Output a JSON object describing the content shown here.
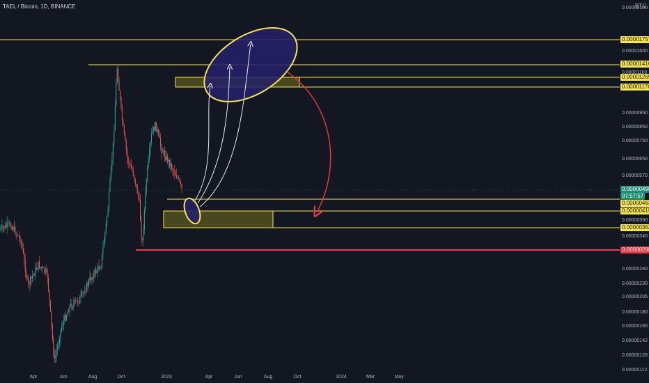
{
  "header": {
    "symbol": "TAEL / Bitcoin, 1D, BINANCE",
    "currency": "BTC"
  },
  "colors": {
    "background": "#131722",
    "up": "#26a69a",
    "down": "#ef5350",
    "yellow": "#f7e54b",
    "zone_fill": "#5b5a1e",
    "ellipse_fill": "#25216b",
    "red_line": "#f23645",
    "current": "#1e8c7a"
  },
  "chart_data": {
    "type": "candlestick",
    "x_ticks": [
      "Apr",
      "Jun",
      "Aug",
      "Oct",
      "2023",
      "Apr",
      "Jun",
      "Aug",
      "Oct",
      "2024",
      "Mar",
      "May"
    ],
    "y_ticks": [
      "0.00002100",
      "0.00001600",
      "0.00001100",
      "0.00000950",
      "0.00000850",
      "0.00000750",
      "0.00000650",
      "0.00000570",
      "0.00000390",
      "0.00000340",
      "0.00000260",
      "0.00000230",
      "0.00000205",
      "0.00000180",
      "0.00000160",
      "0.00000142",
      "0.00000126",
      "0.00000112"
    ],
    "level_labels": [
      {
        "text": "0.00001757",
        "style": "yellow"
      },
      {
        "text": "0.00001410",
        "style": "yellow"
      },
      {
        "text": "0.00001265",
        "style": "yellow"
      },
      {
        "text": "0.00001176",
        "style": "yellow"
      },
      {
        "text": "0.00000498",
        "style": "current"
      },
      {
        "text": "07:57:57",
        "style": "current"
      },
      {
        "text": "0.00000463",
        "style": "yellow"
      },
      {
        "text": "0.00000415",
        "style": "yellow"
      },
      {
        "text": "0.00000362",
        "style": "yellow"
      },
      {
        "text": "0.00000298",
        "style": "red"
      }
    ],
    "price_path_approx": [
      [
        "Mar",
        3.8e-06
      ],
      [
        "Apr",
        2.4e-06
      ],
      [
        "May",
        1.3e-06
      ],
      [
        "Jun",
        1.8e-06
      ],
      [
        "Jul",
        2.1e-06
      ],
      [
        "Aug",
        3.2e-06
      ],
      [
        "Sep",
        6.8e-06
      ],
      [
        "Oct",
        1.25e-05
      ],
      [
        "Nov",
        5.8e-06
      ],
      [
        "Nov",
        3e-06
      ],
      [
        "Dec",
        8.1e-06
      ],
      [
        "Jan",
        5.5e-06
      ],
      [
        "Jan",
        5e-06
      ]
    ]
  }
}
